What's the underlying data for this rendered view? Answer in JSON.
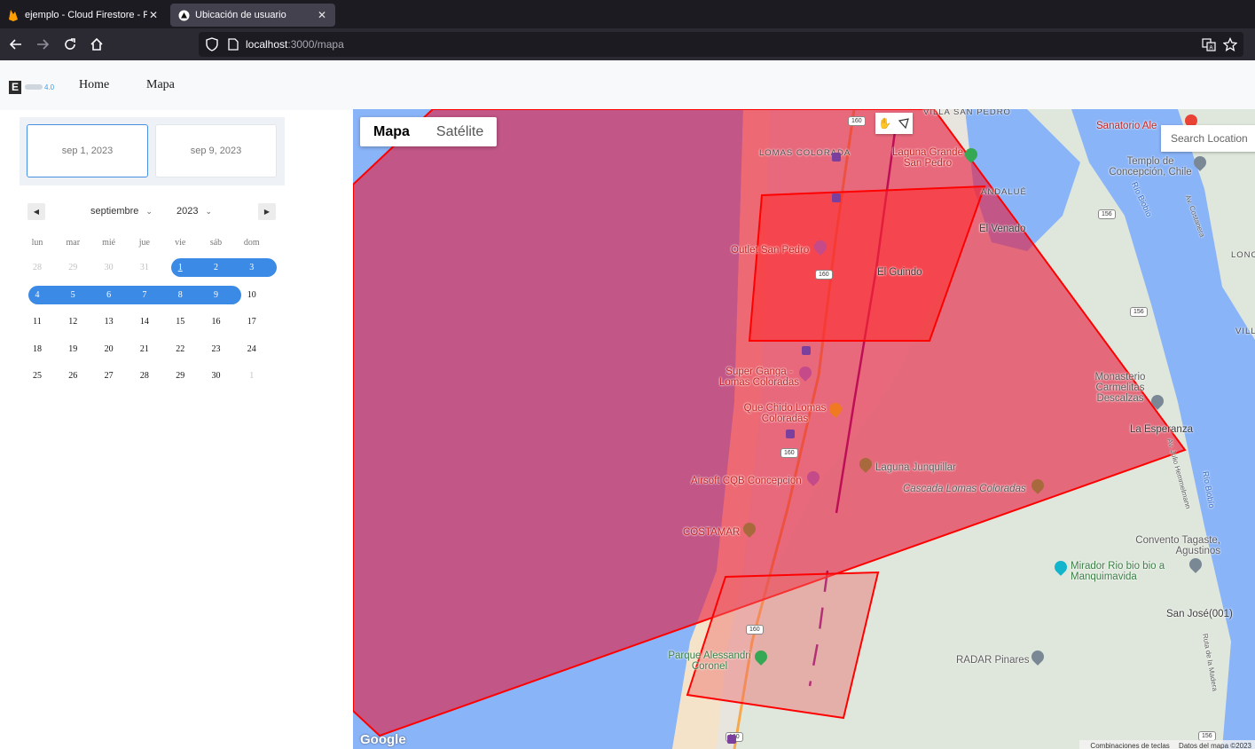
{
  "browser": {
    "tabs": [
      {
        "title": "ejemplo - Cloud Firestore - Fire",
        "active": false
      },
      {
        "title": "Ubicación de usuario",
        "active": true
      }
    ],
    "url_host": "localhost",
    "url_path": ":3000/mapa",
    "icons": [
      "back-icon",
      "forward-icon",
      "reload-icon",
      "home-icon",
      "shield-icon",
      "page-icon",
      "translate-icon",
      "star-icon"
    ]
  },
  "app": {
    "brand_version": "4.0",
    "nav": {
      "home": "Home",
      "map": "Mapa"
    }
  },
  "date_range": {
    "start": "sep 1, 2023",
    "end": "sep 9, 2023"
  },
  "calendar": {
    "month": "septiembre",
    "year": "2023",
    "weekdays": [
      "lun",
      "mar",
      "mié",
      "jue",
      "vie",
      "sáb",
      "dom"
    ],
    "weeks": [
      [
        "28",
        "29",
        "30",
        "31",
        "1",
        "2",
        "3"
      ],
      [
        "4",
        "5",
        "6",
        "7",
        "8",
        "9",
        "10"
      ],
      [
        "11",
        "12",
        "13",
        "14",
        "15",
        "16",
        "17"
      ],
      [
        "18",
        "19",
        "20",
        "21",
        "22",
        "23",
        "24"
      ],
      [
        "25",
        "26",
        "27",
        "28",
        "29",
        "30",
        "1"
      ]
    ],
    "selected_start": "1",
    "selected_end": "9"
  },
  "map": {
    "type_buttons": {
      "map": "Mapa",
      "satellite": "Satélite"
    },
    "search_placeholder": "Search Location",
    "polygon_color": "#ff0000",
    "labels": {
      "villa_san_pedro": "VILLA SAN PEDRO",
      "sanatorio": "Sanatorio Ale",
      "lomas_coloradas": "LOMAS COLORADA",
      "laguna_grande": "Laguna Grande San Pedro",
      "templo": "Templo de Concepción, Chile",
      "rio_biobio_1": "Río Biobío",
      "av_costanera": "Av. Costanera",
      "andalue": "ANDALUÉ",
      "el_venado": "El Venado",
      "outlet": "Outlet San Pedro",
      "el_guindo": "El Guindo",
      "lonco": "LONC",
      "villa": "VILL",
      "super_ganga": "Super Ganga - Lomas Coloradas",
      "que_chido": "Que Chido Lomas Coloradas",
      "monasterio": "Monasterio Carmelitas Descalzas",
      "la_esperanza": "La Esperanza",
      "laguna_junquillar": "Laguna Junquillar",
      "cascada": "Cascada Lomas Coloradas",
      "airsoft": "Airsoft CQB Concepcion",
      "costamar": "COSTAMAR",
      "rio_biobio_2": "Río Biobío",
      "av_hermann": "Av. Julio Hemmelmann",
      "convento": "Convento Tagaste, Agustinos",
      "mirador": "Mirador Rio bio bio a Manquimavida",
      "san_jose": "San José(001)",
      "parque": "Parque Alessandri Coronel",
      "radar": "RADAR Pinares",
      "ruta_madera": "Ruta de la Madera"
    },
    "road_shields": [
      "160",
      "160",
      "160",
      "160",
      "160",
      "156",
      "156",
      "156"
    ],
    "google": "Google",
    "attribution": {
      "shortcuts": "Combinaciones de teclas",
      "data": "Datos del mapa ©2023"
    }
  }
}
